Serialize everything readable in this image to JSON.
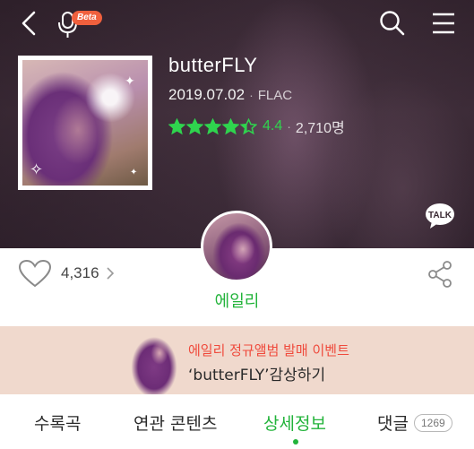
{
  "header": {
    "beta_label": "Beta"
  },
  "album": {
    "title": "butterFLY",
    "release_date": "2019.07.02",
    "separator": "·",
    "format": "FLAC",
    "rating_value": "4.4",
    "rating": 4.4,
    "rating_max": 5,
    "rating_count": "2,710명"
  },
  "actions": {
    "like_count": "4,316"
  },
  "artist": {
    "name": "에일리"
  },
  "banner": {
    "line1": "에일리 정규앨범 발매 이벤트",
    "line2": "‘butterFLY’감상하기"
  },
  "tabs": {
    "tracks": "수록곡",
    "related": "연관 콘텐츠",
    "details": "상세정보",
    "comments": "댓글",
    "comments_count": "1269"
  },
  "colors": {
    "accent": "#22b33a",
    "rating": "#2fd44e",
    "event_red": "#ef4a3c",
    "banner_bg": "#f0d9cd",
    "beta_badge": "#f0603d"
  },
  "icons": [
    "back-icon",
    "microphone-icon",
    "search-icon",
    "menu-icon",
    "star-icon",
    "talk-icon",
    "heart-icon",
    "chevron-right-icon",
    "share-icon"
  ]
}
